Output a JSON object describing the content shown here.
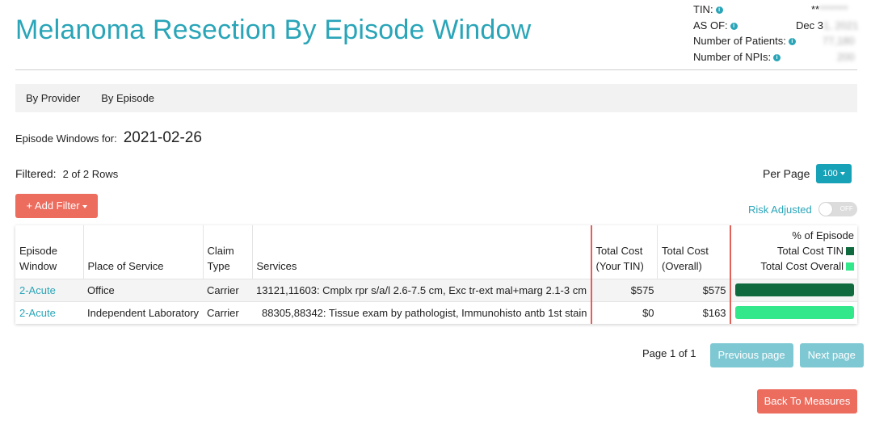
{
  "page": {
    "title": "Melanoma Resection By Episode Window"
  },
  "meta": {
    "tin_label": "TIN:",
    "tin_value_visible": "**",
    "tin_value_redacted": "*******",
    "asof_label": "AS OF:",
    "asof_value_visible": "Dec 3",
    "asof_value_redacted": "1, 2021",
    "patients_label": "Number of Patients:",
    "patients_value_redacted": "77,180",
    "npis_label": "Number of NPIs:",
    "npis_value_redacted": "200"
  },
  "tabs": [
    {
      "label": "By Provider"
    },
    {
      "label": "By Episode"
    }
  ],
  "episode_windows": {
    "label": "Episode Windows for:",
    "date": "2021-02-26"
  },
  "filtered": {
    "label": "Filtered:",
    "value": "2 of 2 Rows"
  },
  "per_page": {
    "label": "Per Page",
    "value": "100"
  },
  "add_filter_label": "+ Add Filter",
  "risk_adjusted": {
    "label": "Risk Adjusted",
    "state": "OFF"
  },
  "table": {
    "headers": {
      "episode_window": [
        "Episode",
        "Window"
      ],
      "place_of_service": "Place of Service",
      "claim_type": [
        "Claim",
        "Type"
      ],
      "services": "Services",
      "total_cost_tin": [
        "Total Cost",
        "(Your TIN)"
      ],
      "total_cost_overall": [
        "Total Cost",
        "(Overall)"
      ],
      "pct_episode": "% of Episode",
      "legend_tin": "Total Cost TIN",
      "legend_overall": "Total Cost Overall"
    },
    "colors": {
      "tin": "#0f6b3d",
      "overall": "#33e88a"
    },
    "rows": [
      {
        "episode_window": "2-Acute",
        "place_of_service": "Office",
        "claim_type": "Carrier",
        "services": "13121,11603: Cmplx rpr s/a/l 2.6-7.5 cm, Exc tr-ext mal+marg 2.1-3 cm",
        "total_cost_tin": "$575",
        "total_cost_overall": "$575",
        "pct_tin": 100,
        "pct_overall": 100
      },
      {
        "episode_window": "2-Acute",
        "place_of_service": "Independent Laboratory",
        "claim_type": "Carrier",
        "services": "88305,88342: Tissue exam by pathologist, Immunohisto antb 1st stain",
        "total_cost_tin": "$0",
        "total_cost_overall": "$163",
        "pct_tin": 0,
        "pct_overall": 100
      }
    ]
  },
  "pager": {
    "label": "Page 1 of 1",
    "previous": "Previous page",
    "next": "Next page"
  },
  "back_label": "Back To Measures"
}
